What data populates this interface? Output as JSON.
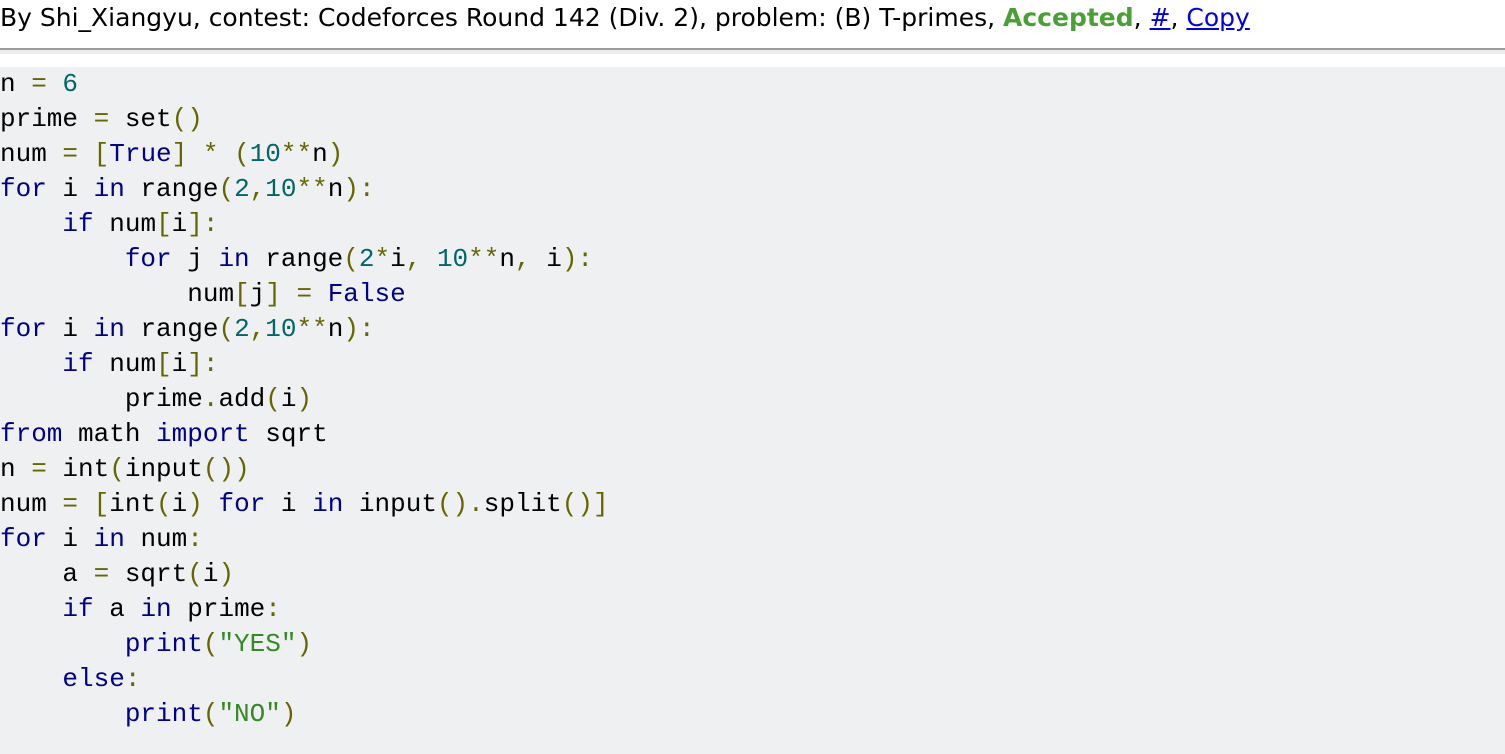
{
  "header": {
    "prefix": "By Shi_Xiangyu, contest: Codeforces Round 142 (Div. 2), problem: (B) T-primes, ",
    "verdict": "Accepted",
    "sep1": ", ",
    "hash_link": "#",
    "sep2": ", ",
    "copy_link": "Copy",
    "verdict_color": "#4aa035"
  },
  "code": {
    "lines": [
      [
        [
          "n",
          "pln"
        ],
        [
          " = ",
          "pun"
        ],
        [
          "6",
          "num"
        ]
      ],
      [
        [
          "prime",
          "pln"
        ],
        [
          " = ",
          "pun"
        ],
        [
          "set",
          "pln"
        ],
        [
          "()",
          "pun"
        ]
      ],
      [
        [
          "num",
          "pln"
        ],
        [
          " = ",
          "pun"
        ],
        [
          "[",
          "pun"
        ],
        [
          "True",
          "kw"
        ],
        [
          "]",
          "pun"
        ],
        [
          " * ",
          "pun"
        ],
        [
          "(",
          "pun"
        ],
        [
          "10",
          "num"
        ],
        [
          "**",
          "pun"
        ],
        [
          "n",
          "pln"
        ],
        [
          ")",
          "pun"
        ]
      ],
      [
        [
          "for",
          "kw"
        ],
        [
          " i ",
          "pln"
        ],
        [
          "in",
          "kw"
        ],
        [
          " range",
          "pln"
        ],
        [
          "(",
          "pun"
        ],
        [
          "2",
          "num"
        ],
        [
          ",",
          "pun"
        ],
        [
          "10",
          "num"
        ],
        [
          "**",
          "pun"
        ],
        [
          "n",
          "pln"
        ],
        [
          "):",
          "pun"
        ]
      ],
      [
        [
          "    ",
          "pln"
        ],
        [
          "if",
          "kw"
        ],
        [
          " num",
          "pln"
        ],
        [
          "[",
          "pun"
        ],
        [
          "i",
          "pln"
        ],
        [
          "]:",
          "pun"
        ]
      ],
      [
        [
          "        ",
          "pln"
        ],
        [
          "for",
          "kw"
        ],
        [
          " j ",
          "pln"
        ],
        [
          "in",
          "kw"
        ],
        [
          " range",
          "pln"
        ],
        [
          "(",
          "pun"
        ],
        [
          "2",
          "num"
        ],
        [
          "*",
          "pun"
        ],
        [
          "i",
          "pln"
        ],
        [
          ", ",
          "pun"
        ],
        [
          "10",
          "num"
        ],
        [
          "**",
          "pun"
        ],
        [
          "n",
          "pln"
        ],
        [
          ", ",
          "pun"
        ],
        [
          "i",
          "pln"
        ],
        [
          "):",
          "pun"
        ]
      ],
      [
        [
          "            ",
          "pln"
        ],
        [
          "num",
          "pln"
        ],
        [
          "[",
          "pun"
        ],
        [
          "j",
          "pln"
        ],
        [
          "]",
          "pun"
        ],
        [
          " = ",
          "pun"
        ],
        [
          "False",
          "kw"
        ]
      ],
      [
        [
          "for",
          "kw"
        ],
        [
          " i ",
          "pln"
        ],
        [
          "in",
          "kw"
        ],
        [
          " range",
          "pln"
        ],
        [
          "(",
          "pun"
        ],
        [
          "2",
          "num"
        ],
        [
          ",",
          "pun"
        ],
        [
          "10",
          "num"
        ],
        [
          "**",
          "pun"
        ],
        [
          "n",
          "pln"
        ],
        [
          "):",
          "pun"
        ]
      ],
      [
        [
          "    ",
          "pln"
        ],
        [
          "if",
          "kw"
        ],
        [
          " num",
          "pln"
        ],
        [
          "[",
          "pun"
        ],
        [
          "i",
          "pln"
        ],
        [
          "]:",
          "pun"
        ]
      ],
      [
        [
          "        ",
          "pln"
        ],
        [
          "prime",
          "pln"
        ],
        [
          ".",
          "pun"
        ],
        [
          "add",
          "pln"
        ],
        [
          "(",
          "pun"
        ],
        [
          "i",
          "pln"
        ],
        [
          ")",
          "pun"
        ]
      ],
      [
        [
          "from",
          "kw"
        ],
        [
          " math ",
          "pln"
        ],
        [
          "import",
          "kw"
        ],
        [
          " sqrt",
          "pln"
        ]
      ],
      [
        [
          "n",
          "pln"
        ],
        [
          " = ",
          "pun"
        ],
        [
          "int",
          "pln"
        ],
        [
          "(",
          "pun"
        ],
        [
          "input",
          "pln"
        ],
        [
          "())",
          "pun"
        ]
      ],
      [
        [
          "num",
          "pln"
        ],
        [
          " = ",
          "pun"
        ],
        [
          "[",
          "pun"
        ],
        [
          "int",
          "pln"
        ],
        [
          "(",
          "pun"
        ],
        [
          "i",
          "pln"
        ],
        [
          ") ",
          "pun"
        ],
        [
          "for",
          "kw"
        ],
        [
          " i ",
          "pln"
        ],
        [
          "in",
          "kw"
        ],
        [
          " input",
          "pln"
        ],
        [
          "().",
          "pun"
        ],
        [
          "split",
          "pln"
        ],
        [
          "()]",
          "pun"
        ]
      ],
      [
        [
          "for",
          "kw"
        ],
        [
          " i ",
          "pln"
        ],
        [
          "in",
          "kw"
        ],
        [
          " num",
          "pln"
        ],
        [
          ":",
          "pun"
        ]
      ],
      [
        [
          "    a",
          "pln"
        ],
        [
          " = ",
          "pun"
        ],
        [
          "sqrt",
          "pln"
        ],
        [
          "(",
          "pun"
        ],
        [
          "i",
          "pln"
        ],
        [
          ")",
          "pun"
        ]
      ],
      [
        [
          "    ",
          "pln"
        ],
        [
          "if",
          "kw"
        ],
        [
          " a ",
          "pln"
        ],
        [
          "in",
          "kw"
        ],
        [
          " prime",
          "pln"
        ],
        [
          ":",
          "pun"
        ]
      ],
      [
        [
          "        ",
          "pln"
        ],
        [
          "print",
          "kw"
        ],
        [
          "(",
          "pun"
        ],
        [
          "\"YES\"",
          "str"
        ],
        [
          ")",
          "pun"
        ]
      ],
      [
        [
          "    ",
          "pln"
        ],
        [
          "else",
          "kw"
        ],
        [
          ":",
          "pun"
        ]
      ],
      [
        [
          "        ",
          "pln"
        ],
        [
          "print",
          "kw"
        ],
        [
          "(",
          "pun"
        ],
        [
          "\"NO\"",
          "str"
        ],
        [
          ")",
          "pun"
        ]
      ]
    ]
  }
}
